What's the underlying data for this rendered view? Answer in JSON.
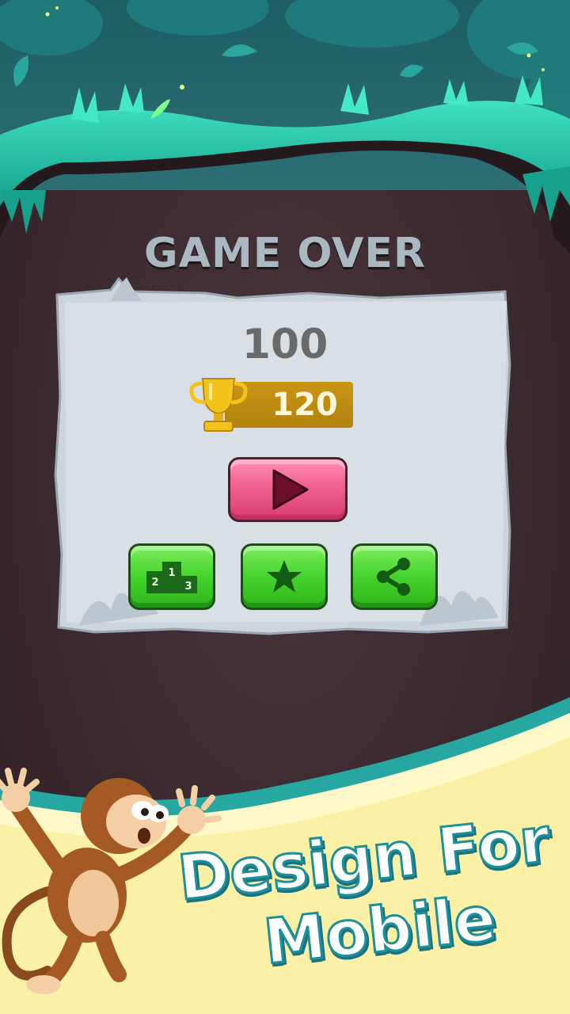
{
  "screen": {
    "title": "GAME OVER",
    "score": "100",
    "best_score": "120"
  },
  "buttons": {
    "play": "play-icon",
    "leaderboard": "podium-icon",
    "leaderboard_places": [
      "1",
      "2",
      "3"
    ],
    "rate": "star-icon",
    "share": "share-icon"
  },
  "promo": {
    "line1": "Design For",
    "line2": "Mobile"
  },
  "colors": {
    "background": "#3b2a30",
    "jungle": "#23b8a3",
    "panel": "#d3dbe1",
    "play_button": "#f0608f",
    "green_button": "#46d22c",
    "best_bar": "#c99514",
    "banner": "#fbf1a6"
  }
}
